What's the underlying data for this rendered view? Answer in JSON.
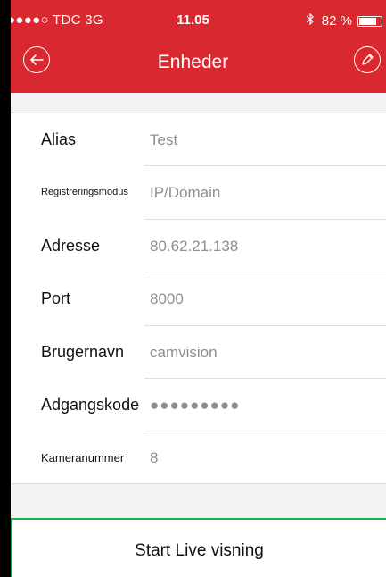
{
  "status_bar": {
    "carrier": "●●●●○ TDC  3G",
    "time": "11.05",
    "battery_text": "82 %",
    "battery_level": 0.82,
    "bluetooth_icon": "bluetooth-icon"
  },
  "nav": {
    "title": "Enheder",
    "back_icon": "back-arrow-circle-icon",
    "edit_icon": "pencil-circle-icon"
  },
  "fields": [
    {
      "label": "Alias",
      "value": "Test"
    },
    {
      "label": "Registreringsmodus",
      "value": "IP/Domain"
    },
    {
      "label": "Adresse",
      "value": "80.62.21.138"
    },
    {
      "label": "Port",
      "value": "8000"
    },
    {
      "label": "Brugernavn",
      "value": "camvision"
    },
    {
      "label": "Adgangskode",
      "value": "●●●●●●●●●"
    },
    {
      "label": "Kameranummer",
      "value": "8"
    }
  ],
  "action": {
    "label": "Start Live visning"
  },
  "colors": {
    "header": "#d9282f",
    "highlight_border": "#1fae4f"
  }
}
